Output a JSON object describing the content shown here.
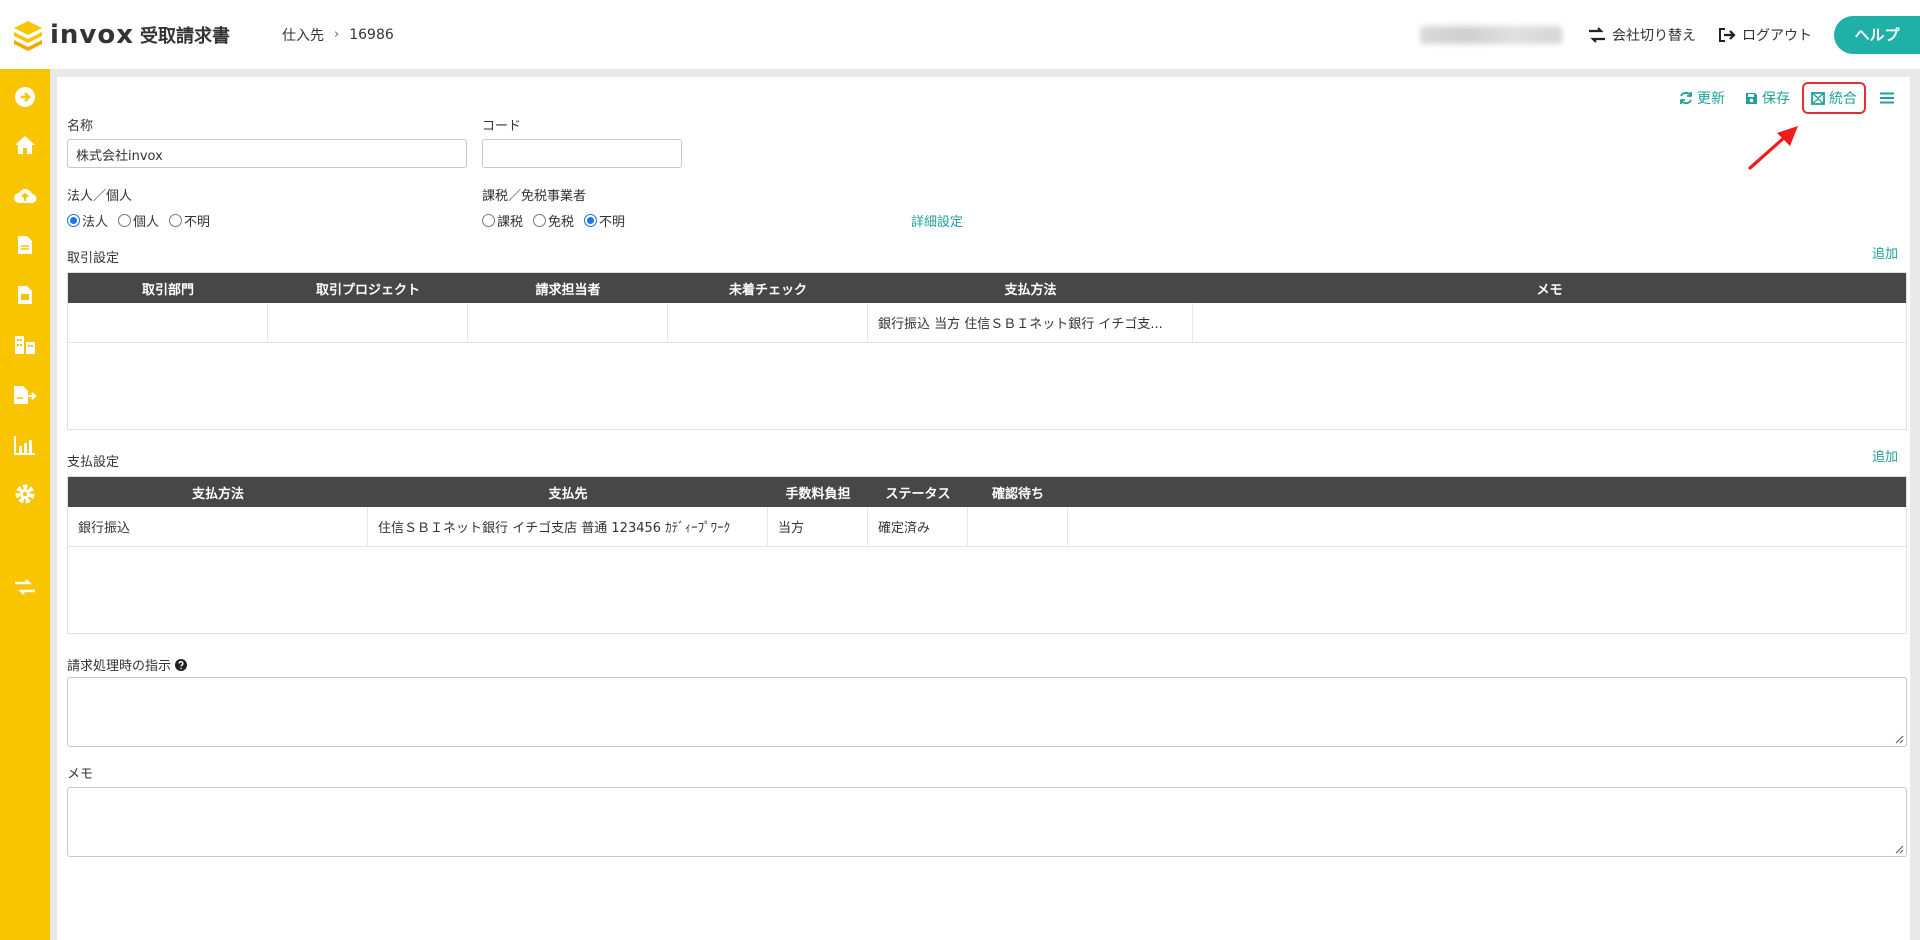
{
  "header": {
    "logo_text": "invox",
    "logo_sub": "受取請求書",
    "breadcrumb": [
      "仕入先",
      "16986"
    ],
    "switch_company": "会社切り替え",
    "logout": "ログアウト",
    "help": "ヘルプ"
  },
  "toolbar": {
    "refresh": "更新",
    "save": "保存",
    "merge": "統合"
  },
  "form": {
    "name_label": "名称",
    "name_value": "株式会社invox",
    "code_label": "コード",
    "code_value": "",
    "entity_label": "法人／個人",
    "entity_options": [
      "法人",
      "個人",
      "不明"
    ],
    "entity_selected": "法人",
    "tax_label": "課税／免税事業者",
    "tax_options": [
      "課税",
      "免税",
      "不明"
    ],
    "tax_selected": "不明",
    "detail_link": "詳細設定"
  },
  "transaction": {
    "title": "取引設定",
    "add": "追加",
    "columns": [
      "取引部門",
      "取引プロジェクト",
      "請求担当者",
      "未着チェック",
      "支払方法",
      "メモ"
    ],
    "rows": [
      [
        "",
        "",
        "",
        "",
        "銀行振込 当方 住信ＳＢＩネット銀行 イチゴ支...",
        ""
      ]
    ]
  },
  "payment": {
    "title": "支払設定",
    "add": "追加",
    "columns": [
      "支払方法",
      "支払先",
      "手数料負担",
      "ステータス",
      "確認待ち",
      ""
    ],
    "rows": [
      [
        "銀行振込",
        "住信ＳＢＩネット銀行 イチゴ支店 普通 123456 ｶﾃﾞｨｰﾌﾟﾜｰｸ",
        "当方",
        "確定済み",
        "",
        ""
      ]
    ]
  },
  "instructions": {
    "label": "請求処理時の指示"
  },
  "memo": {
    "label": "メモ"
  },
  "colors": {
    "accent": "#1fb0a8",
    "sidebar": "#f9c400",
    "table_header": "#474747",
    "highlight": "#e03030"
  }
}
